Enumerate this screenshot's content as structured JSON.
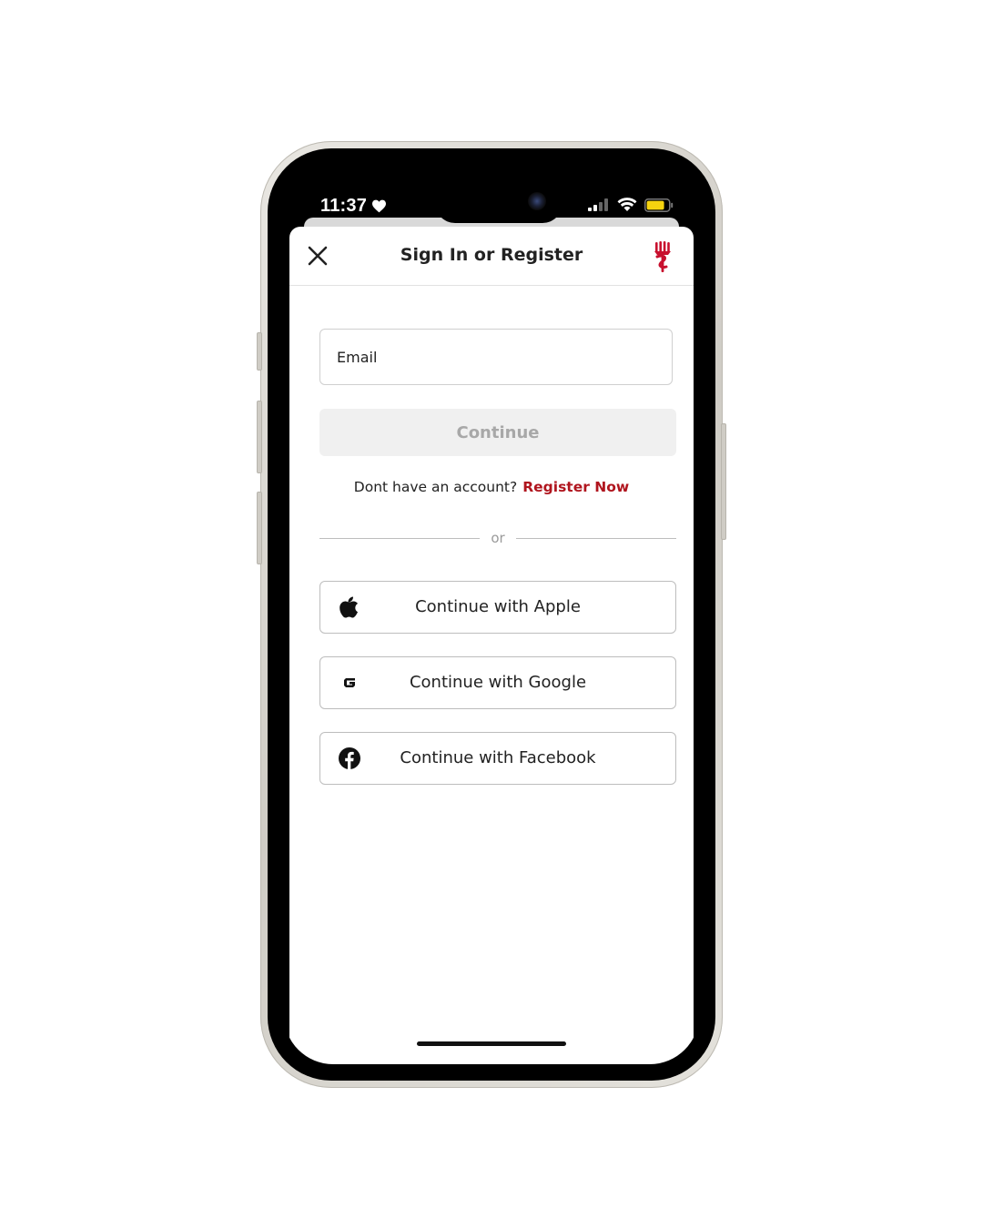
{
  "status_bar": {
    "time": "11:37",
    "heart_icon": "heart-icon",
    "signal_icon": "signal-bars-icon",
    "wifi_icon": "wifi-icon",
    "battery_icon": "battery-icon",
    "battery_color": "#f5d30f"
  },
  "header": {
    "title": "Sign In or Register",
    "close_icon": "close-icon",
    "logo_icon": "brand-logo-icon",
    "logo_color": "#c8102e"
  },
  "form": {
    "email_placeholder": "Email",
    "email_value": "",
    "continue_label": "Continue"
  },
  "register": {
    "prompt": "Dont have an account?",
    "link_label": "Register Now",
    "link_color": "#b0151e"
  },
  "divider": {
    "label": "or"
  },
  "social": [
    {
      "label": "Continue with Apple",
      "icon": "apple-icon"
    },
    {
      "label": "Continue with Google",
      "icon": "google-icon"
    },
    {
      "label": "Continue with Facebook",
      "icon": "facebook-icon"
    }
  ]
}
